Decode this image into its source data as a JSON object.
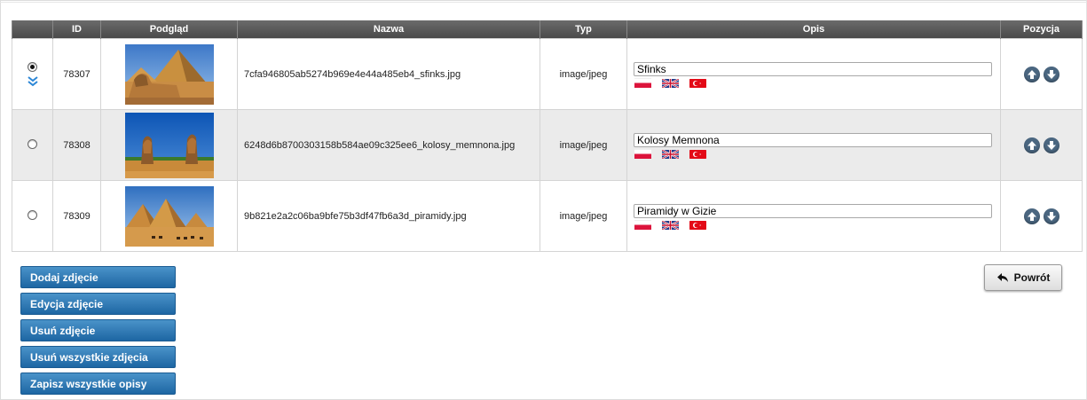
{
  "table": {
    "headers": {
      "select": "",
      "id": "ID",
      "preview": "Podgląd",
      "name": "Nazwa",
      "type": "Typ",
      "description": "Opis",
      "position": "Pozycja"
    },
    "rows": [
      {
        "selected": true,
        "id": "78307",
        "image_subject": "sphinx-and-pyramids",
        "name": "7cfa946805ab5274b969e4e44a485eb4_sfinks.jpg",
        "type": "image/jpeg",
        "description": "Sfinks"
      },
      {
        "selected": false,
        "id": "78308",
        "image_subject": "colossi-of-memnon",
        "name": "6248d6b8700303158b584ae09c325ee6_kolosy_memnona.jpg",
        "type": "image/jpeg",
        "description": "Kolosy Memnona"
      },
      {
        "selected": false,
        "id": "78309",
        "image_subject": "pyramids-of-giza",
        "name": "9b821e2a2c06ba9bfe75b3df47fb6a3d_piramidy.jpg",
        "type": "image/jpeg",
        "description": "Piramidy w Gizie"
      }
    ],
    "language_flags": [
      "pl-flag-icon",
      "gb-flag-icon",
      "tr-flag-icon"
    ]
  },
  "actions": {
    "add_photo": "Dodaj zdjęcie",
    "edit_photo": "Edycja zdjęcie",
    "delete_photo": "Usuń zdjęcie",
    "delete_all_photos": "Usuń wszystkie zdjęcia",
    "save_all_descriptions": "Zapisz wszystkie opisy",
    "back": "Powrót"
  },
  "colors": {
    "header_bg": "#555555",
    "button_blue": "#2a78b5",
    "alt_row_bg": "#ebebeb",
    "move_button": "#4a6680"
  }
}
